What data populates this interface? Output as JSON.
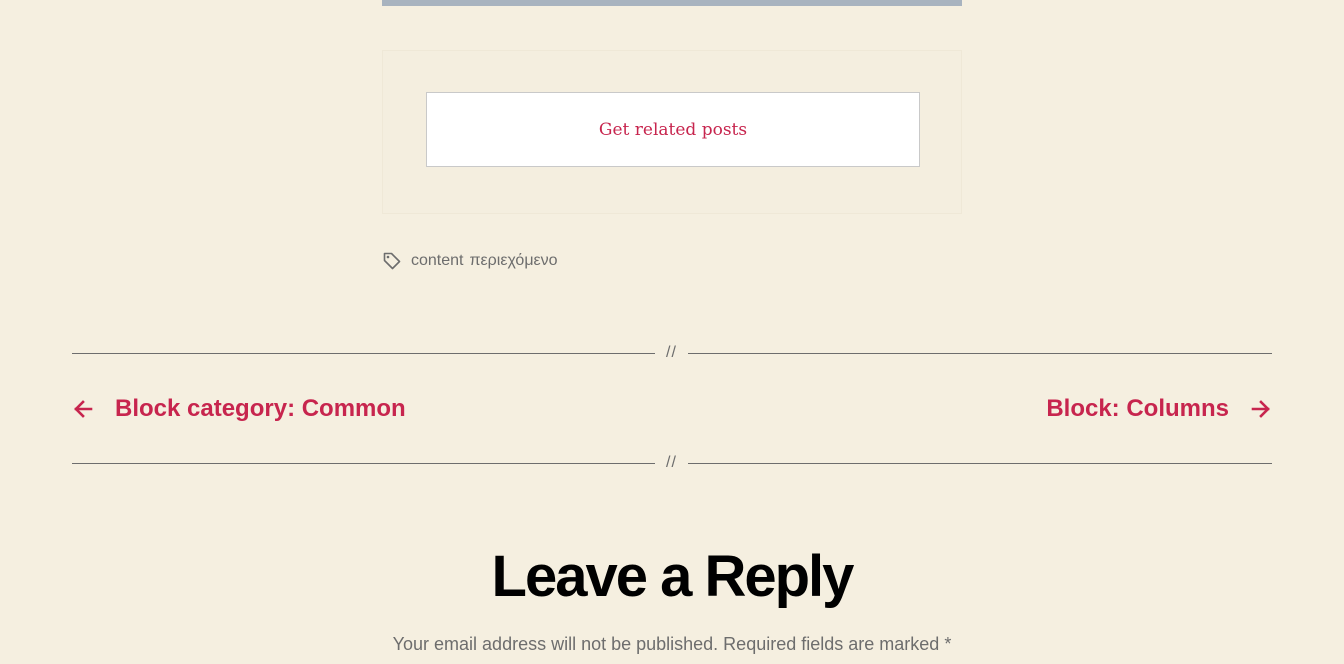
{
  "related_posts": {
    "button_label": "Get related posts"
  },
  "tags": {
    "icon": "tag-icon",
    "items": [
      "content",
      "περιεχόμενο"
    ]
  },
  "divider": {
    "separator": "//"
  },
  "post_navigation": {
    "previous": {
      "label": "Block category: Common",
      "icon": "arrow-left-icon"
    },
    "next": {
      "label": "Block: Columns",
      "icon": "arrow-right-icon"
    }
  },
  "comments": {
    "title": "Leave a Reply",
    "notes": "Your email address will not be published. Required fields are marked",
    "required_marker": "*"
  },
  "colors": {
    "background": "#f5efe0",
    "accent": "#c7254e",
    "muted_text": "#6d6d6d",
    "image_bar": "#a8b3bf"
  }
}
